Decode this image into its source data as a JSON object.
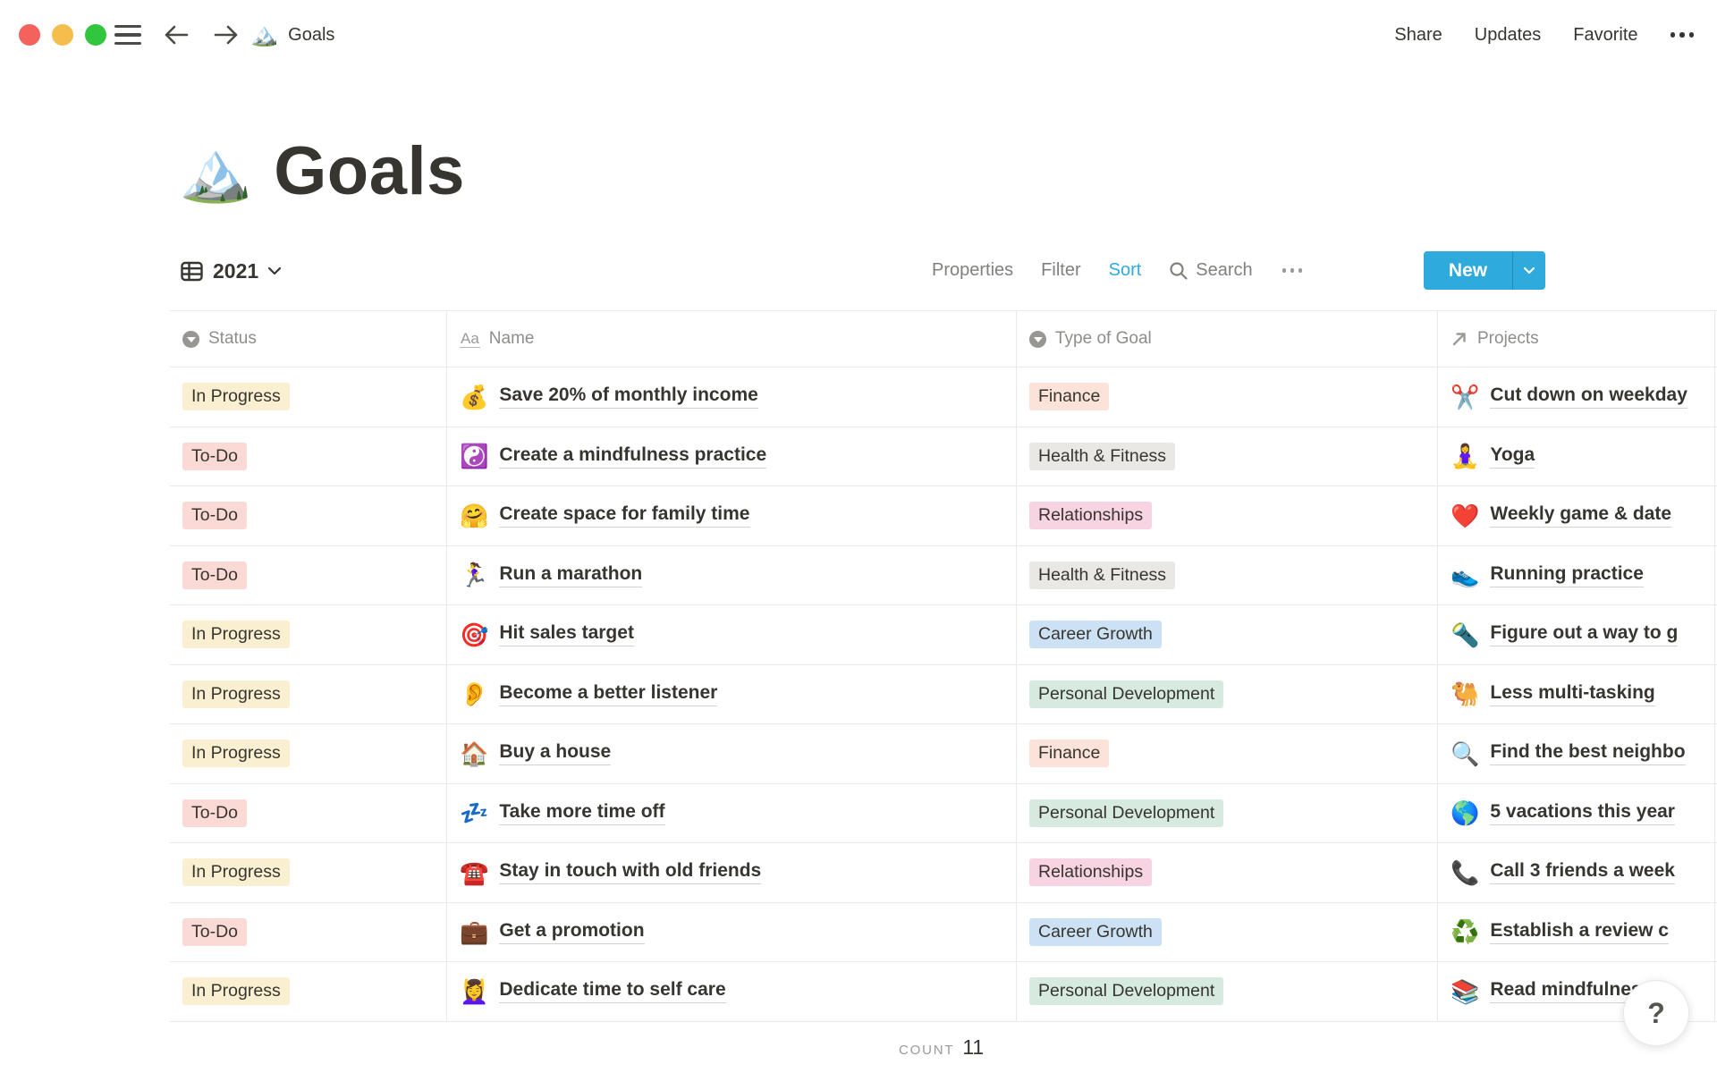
{
  "topbar": {
    "emoji": "🏔️",
    "title": "Goals",
    "share": "Share",
    "updates": "Updates",
    "favorite": "Favorite",
    "more_icon": "ellipsis"
  },
  "page": {
    "emoji": "🏔️",
    "title": "Goals"
  },
  "toolbar": {
    "view_name": "2021",
    "properties": "Properties",
    "filter": "Filter",
    "sort": "Sort",
    "search_label": "Search",
    "new_label": "New"
  },
  "table": {
    "columns": [
      {
        "label": "Status",
        "icon": "select-icon"
      },
      {
        "label": "Name",
        "icon": "text-icon"
      },
      {
        "label": "Type of Goal",
        "icon": "select-icon"
      },
      {
        "label": "Projects",
        "icon": "relation-arrow-icon"
      }
    ],
    "rows": [
      {
        "status": "In Progress",
        "status_color": "yellow",
        "emoji": "💰",
        "name": "Save 20% of monthly income",
        "type": "Finance",
        "type_color": "orange",
        "project_emoji": "✂️",
        "project": "Cut down on weekday"
      },
      {
        "status": "To-Do",
        "status_color": "red",
        "emoji": "☯️",
        "name": "Create a mindfulness practice",
        "type": "Health & Fitness",
        "type_color": "gray",
        "project_emoji": "🧘‍♀️",
        "project": "Yoga"
      },
      {
        "status": "To-Do",
        "status_color": "red",
        "emoji": "🤗",
        "name": "Create space for family time",
        "type": "Relationships",
        "type_color": "pink",
        "project_emoji": "❤️",
        "project": "Weekly game & date"
      },
      {
        "status": "To-Do",
        "status_color": "red",
        "emoji": "🏃‍♀️",
        "name": "Run a marathon",
        "type": "Health & Fitness",
        "type_color": "gray",
        "project_emoji": "👟",
        "project": "Running practice"
      },
      {
        "status": "In Progress",
        "status_color": "yellow",
        "emoji": "🎯",
        "name": "Hit sales target",
        "type": "Career Growth",
        "type_color": "blue",
        "project_emoji": "🔦",
        "project": "Figure out a way to g"
      },
      {
        "status": "In Progress",
        "status_color": "yellow",
        "emoji": "👂",
        "name": "Become a better listener",
        "type": "Personal Development",
        "type_color": "green",
        "project_emoji": "🐫",
        "project": "Less multi-tasking"
      },
      {
        "status": "In Progress",
        "status_color": "yellow",
        "emoji": "🏠",
        "name": "Buy a house",
        "type": "Finance",
        "type_color": "orange",
        "project_emoji": "🔍",
        "project": "Find the best neighbo"
      },
      {
        "status": "To-Do",
        "status_color": "red",
        "emoji": "💤",
        "name": "Take more time off",
        "type": "Personal Development",
        "type_color": "green",
        "project_emoji": "🌎",
        "project": "5 vacations this year"
      },
      {
        "status": "In Progress",
        "status_color": "yellow",
        "emoji": "☎️",
        "name": "Stay in touch with old friends",
        "type": "Relationships",
        "type_color": "pink",
        "project_emoji": "📞",
        "project": "Call 3 friends a week"
      },
      {
        "status": "To-Do",
        "status_color": "red",
        "emoji": "💼",
        "name": "Get a promotion",
        "type": "Career Growth",
        "type_color": "blue",
        "project_emoji": "♻️",
        "project": "Establish a review c"
      },
      {
        "status": "In Progress",
        "status_color": "yellow",
        "emoji": "💆‍♀️",
        "name": "Dedicate time to self care",
        "type": "Personal Development",
        "type_color": "green",
        "project_emoji": "📚",
        "project": "Read mindfulness b"
      }
    ],
    "count_label": "COUNT",
    "count_value": "11"
  },
  "help": {
    "label": "?"
  },
  "colors": {
    "accent_blue": "#2EAADC",
    "text": "#37352F",
    "gray_text": "#8F8D89",
    "border": "#E9E9E7",
    "badge_yellow": "#FAF0D1",
    "badge_red": "#FBDAD6",
    "badge_orange": "#FBE3D9",
    "badge_gray": "#E9E8E5",
    "badge_pink": "#F8D3E2",
    "badge_blue": "#CDE1F5",
    "badge_green": "#D6EADF",
    "traffic_red": "#F4625D",
    "traffic_yellow": "#F5BD4C",
    "traffic_green": "#32C63E"
  }
}
